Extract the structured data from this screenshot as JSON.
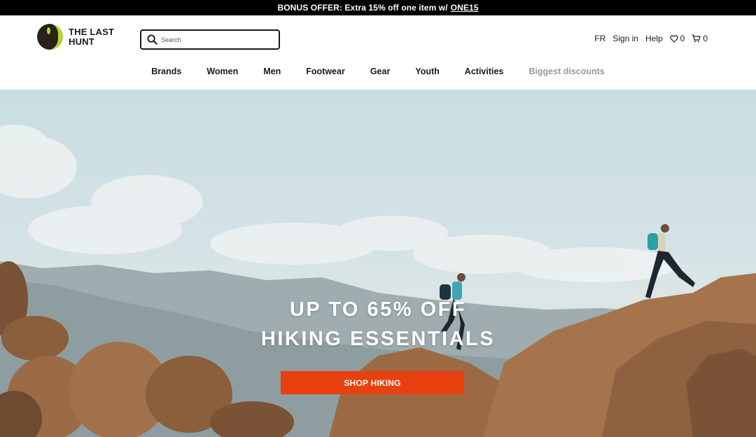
{
  "promo": {
    "text": "BONUS OFFER: Extra 15% off one item w/",
    "code": "ONE15"
  },
  "brand": {
    "line1": "THE LAST",
    "line2": "HUNT"
  },
  "search": {
    "placeholder": "Search"
  },
  "utility": {
    "language": "FR",
    "sign_in": "Sign in",
    "help": "Help",
    "wishlist_count": "0",
    "cart_count": "0"
  },
  "nav": [
    "Brands",
    "Women",
    "Men",
    "Footwear",
    "Gear",
    "Youth",
    "Activities",
    "Biggest discounts"
  ],
  "hero": {
    "headline_line1": "UP TO 65% OFF",
    "headline_line2": "HIKING ESSENTIALS",
    "cta": "SHOP HIKING"
  },
  "colors": {
    "cta": "#e8400f",
    "promo_bg": "#000000",
    "logo_accent": "#b5d334"
  }
}
